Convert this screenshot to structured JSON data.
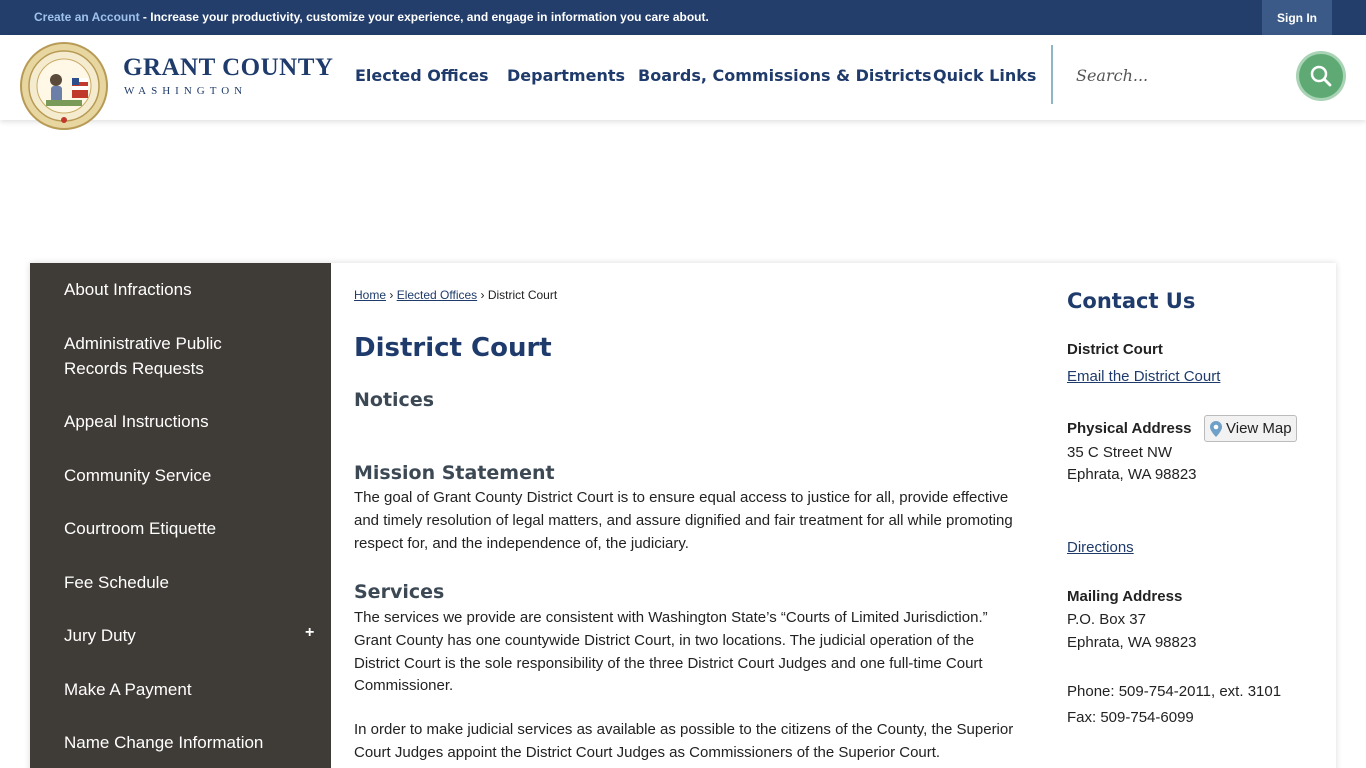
{
  "topbar": {
    "create_account": "Create an Account",
    "message": " - Increase your productivity, customize your experience, and engage in information you care about.",
    "sign_in": "Sign In"
  },
  "brand": {
    "name": "GRANT COUNTY",
    "sub": "WASHINGTON"
  },
  "nav": [
    "Elected Offices",
    "Departments",
    "Boards, Commissions & Districts",
    "Quick Links"
  ],
  "search": {
    "placeholder": "Search..."
  },
  "sidebar": {
    "items": [
      "About Infractions",
      "Administrative Public Records Requests",
      "Appeal Instructions",
      "Community Service",
      "Courtroom Etiquette",
      "Fee Schedule",
      "Jury Duty",
      "Make A Payment",
      "Name Change Information"
    ],
    "expand_symbol": "+"
  },
  "breadcrumb": {
    "home": "Home",
    "sep1": " › ",
    "elected": "Elected Offices",
    "sep2": " › ",
    "current": "District Court"
  },
  "main": {
    "title": "District Court",
    "notices_heading": "Notices",
    "mission_heading": "Mission Statement",
    "mission_text": "The goal of Grant County District Court is to ensure equal access to justice for all, provide effective and timely resolution of legal matters, and assure dignified and fair treatment for all while promoting respect for, and the independence of, the judiciary.",
    "services_heading": "Services",
    "services_text1": "The services we provide are consistent with Washington State’s “Courts of Limited Jurisdiction.” Grant County has one countywide District Court, in two locations. The judicial operation of the District Court is the sole responsibility of the three District Court Judges and one full-time Court Commissioner.",
    "services_text2": "In order to make judicial services as available as possible to the citizens of the County, the Superior Court Judges appoint the District Court Judges as Commissioners of the Superior Court."
  },
  "contact": {
    "title": "Contact Us",
    "dept": "District Court",
    "email_link": "Email the District Court",
    "physical_label": "Physical Address",
    "view_map": "View Map",
    "phys_line1": "35 C Street NW",
    "phys_line2": "Ephrata, WA 98823",
    "directions": "Directions",
    "mailing_label": "Mailing Address",
    "mail_line1": "P.O. Box 37",
    "mail_line2": "Ephrata, WA 98823",
    "phone": "Phone: 509-754-2011, ext. 3101",
    "fax": "Fax: 509-754-6099"
  },
  "colors": {
    "topbar": "#233e6b",
    "brand_blue": "#1f3b6b",
    "sidebar": "#3f3b36",
    "search_button": "#5faa74"
  }
}
